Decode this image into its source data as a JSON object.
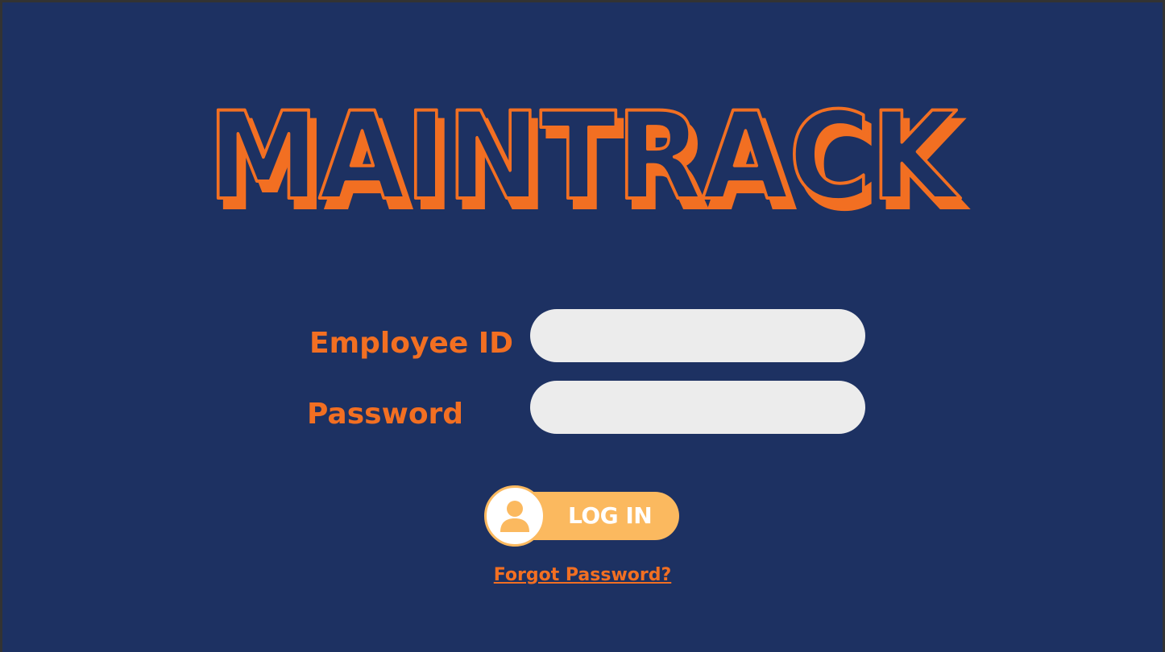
{
  "app": {
    "logo_text": "MAINTRACK"
  },
  "form": {
    "employee_id_label": "Employee ID",
    "employee_id_value": "",
    "password_label": "Password",
    "password_value": "",
    "login_label": "LOG IN",
    "forgot_password_label": "Forgot Password?"
  },
  "icons": {
    "login_icon": "user-icon"
  },
  "colors": {
    "background": "#1d3162",
    "accent_orange": "#f26f22",
    "button_yellow": "#fbb95f",
    "input_fill": "#ececec"
  }
}
